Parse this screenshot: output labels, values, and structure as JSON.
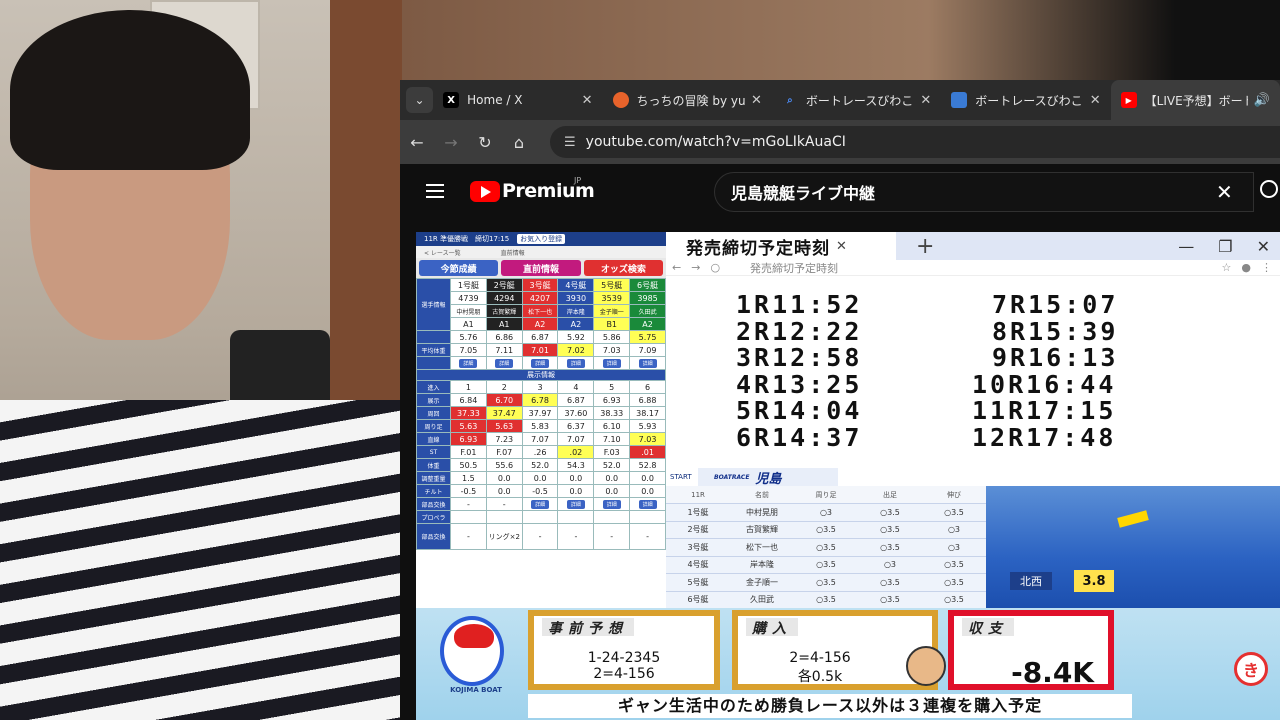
{
  "browser": {
    "tabs": [
      {
        "label": "Home / X",
        "icon": "x-logo-icon",
        "fav": "X",
        "color": "#000000"
      },
      {
        "label": "ちっちの冒険 by yusuk",
        "icon": "avatar-icon",
        "fav": "",
        "color": "#e8632b"
      },
      {
        "label": "ボートレースびわこ - 検",
        "icon": "search-icon",
        "fav": "🔍",
        "color": "#2b2b2b"
      },
      {
        "label": "ボートレースびわこ Offic",
        "icon": "boatrace-logo-icon",
        "fav": "",
        "color": "#3a7bd5"
      },
      {
        "label": "【LIVE予想】ボート",
        "icon": "youtube-icon",
        "fav": "▶",
        "color": "#ff0000"
      }
    ],
    "url": "youtube.com/watch?v=mGoLIkAuaCI"
  },
  "youtube": {
    "brand": "Premium",
    "region": "JP",
    "search_value": "児島競艇ライブ中継"
  },
  "left_panel": {
    "header": "11R 準優勝戦　締切17:15",
    "fav_button": "お気入り登録",
    "back": "< レース一覧",
    "sub_title": "直前情報",
    "tabs": [
      "今節成績",
      "直前情報",
      "オッズ検索"
    ],
    "boats": [
      "1号艇",
      "2号艇",
      "3号艇",
      "4号艇",
      "5号艇",
      "6号艇"
    ],
    "reg_nos": [
      "4739",
      "4294",
      "4207",
      "3930",
      "3539",
      "3985"
    ],
    "names": [
      "中村晃朋",
      "古賀繁輝",
      "松下一也",
      "岸本隆",
      "金子順一",
      "久田武"
    ],
    "classes": [
      "A1",
      "A1",
      "A2",
      "A2",
      "B1",
      "A2"
    ],
    "row_labels": {
      "player": "選手情報",
      "avg": "平均体重",
      "exhibit_title": "展示情報",
      "entry": "進入",
      "time": "展示",
      "lap": "周回",
      "turn": "周り足",
      "straight": "直線",
      "st": "ST",
      "weight": "体重",
      "adj": "調整重量",
      "tilt": "チルト",
      "parts": "部品交換",
      "propeller": "プロペラ",
      "note": "部品交換"
    },
    "ability": [
      "5.76",
      "6.86",
      "6.87",
      "5.92",
      "5.86",
      "5.75"
    ],
    "avg": [
      "7.05",
      "7.11",
      "7.01",
      "7.02",
      "7.03",
      "7.09"
    ],
    "entry": [
      "1",
      "2",
      "3",
      "4",
      "5",
      "6"
    ],
    "time": [
      "6.84",
      "6.70",
      "6.78",
      "6.87",
      "6.93",
      "6.88"
    ],
    "lap": [
      "37.33",
      "37.47",
      "37.97",
      "37.60",
      "38.33",
      "38.17"
    ],
    "turn": [
      "5.63",
      "5.63",
      "5.83",
      "6.37",
      "6.10",
      "5.93"
    ],
    "straight": [
      "6.93",
      "7.23",
      "7.07",
      "7.07",
      "7.10",
      "7.03"
    ],
    "st": [
      "F.01",
      "F.07",
      ".26",
      ".02",
      "F.03",
      ".01"
    ],
    "weight": [
      "50.5",
      "55.6",
      "52.0",
      "54.3",
      "52.0",
      "52.8"
    ],
    "adj": [
      "1.5",
      "0.0",
      "0.0",
      "0.0",
      "0.0",
      "0.0"
    ],
    "tilt": [
      "-0.5",
      "0.0",
      "-0.5",
      "0.0",
      "0.0",
      "0.0"
    ],
    "detail_btn": "詳細",
    "parts_note": "リング×2",
    "dash": "-"
  },
  "schedule": {
    "tab_title": "発売締切予定時刻",
    "url_text": "発売締切予定時刻",
    "left": [
      {
        "r": "1R",
        "t": "11:52"
      },
      {
        "r": "2R",
        "t": "12:22"
      },
      {
        "r": "3R",
        "t": "12:58"
      },
      {
        "r": "4R",
        "t": "13:25"
      },
      {
        "r": "5R",
        "t": "14:04"
      },
      {
        "r": "6R",
        "t": "14:37"
      }
    ],
    "right": [
      {
        "r": "7R",
        "t": "15:07"
      },
      {
        "r": "8R",
        "t": "15:39"
      },
      {
        "r": "9R",
        "t": "16:13"
      },
      {
        "r": "10R",
        "t": "16:44"
      },
      {
        "r": "11R",
        "t": "17:15"
      },
      {
        "r": "12R",
        "t": "17:48"
      }
    ]
  },
  "race": {
    "start": "START",
    "venue": "児島",
    "boatrace_small": "BOATRACE",
    "headers": [
      "11R",
      "名前",
      "周り足",
      "出足",
      "伸び"
    ],
    "rows": [
      [
        "1号艇",
        "中村晃朋",
        "○3",
        "○3.5",
        "○3.5"
      ],
      [
        "2号艇",
        "古賀繁輝",
        "○3.5",
        "○3.5",
        "○3"
      ],
      [
        "3号艇",
        "松下一也",
        "○3.5",
        "○3.5",
        "○3"
      ],
      [
        "4号艇",
        "岸本隆",
        "○3.5",
        "○3",
        "○3.5"
      ],
      [
        "5号艇",
        "金子順一",
        "○3.5",
        "○3.5",
        "○3.5"
      ],
      [
        "6号艇",
        "久田武",
        "○3.5",
        "○3.5",
        "○3.5"
      ]
    ],
    "wind_dir": "北西",
    "wind_speed": "3.8"
  },
  "overlay": {
    "box1_title": "事前予想",
    "box1_line1": "1-24-2345",
    "box1_line2": "2=4-156",
    "box2_title": "購入",
    "box2_line1": "2=4-156",
    "box2_line2": "各0.5k",
    "box3_title": "収支",
    "box3_value": "-8.4K",
    "ticker": "ギャン生活中のため勝負レース以外は３連複を購入予定",
    "mascot_text": "KOJIMA BOAT",
    "corner_logo": "き"
  }
}
